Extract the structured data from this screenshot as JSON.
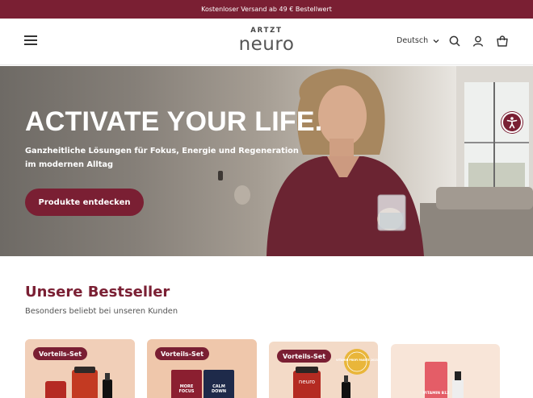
{
  "announcement": {
    "text": "Kostenloser Versand ab 49 € Bestellwert"
  },
  "header": {
    "logo_top": "ARTZT",
    "logo_main": "neuro",
    "language": "Deutsch"
  },
  "hero": {
    "title": "ACTIVATE YOUR LIFE.",
    "subtitle": "Ganzheitliche Lösungen für Fokus, Energie und Regeneration im modernen Alltag",
    "cta": "Produkte entdecken"
  },
  "bestsellers": {
    "title": "Unsere Bestseller",
    "subtitle": "Besonders beliebt bei unseren Kunden",
    "products": [
      {
        "badge": "Vorteils-Set",
        "bg": "#f3d2bd"
      },
      {
        "badge": "Vorteils-Set",
        "bg": "#f1c9ae"
      },
      {
        "badge": "Vorteils-Set",
        "bg": "#f4dccb",
        "seal": "VITAMIN PROFI PAKETE 2023"
      },
      {
        "bg": "#f8e6da",
        "label": "VITAMIN B12"
      }
    ]
  },
  "colors": {
    "brand": "#7a1f33"
  }
}
